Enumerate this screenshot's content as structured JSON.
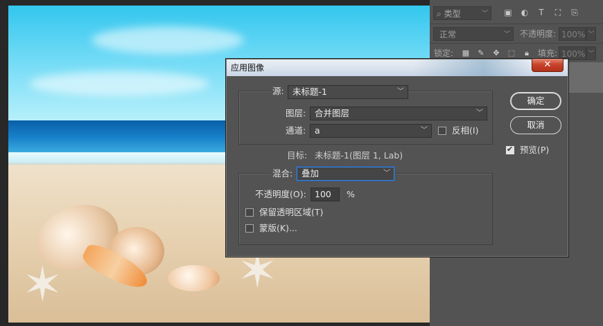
{
  "dialog": {
    "title": "应用图像",
    "close_glyph": "✕",
    "source_label": "源:",
    "source_value": "未标题-1",
    "layer_label": "图层:",
    "layer_value": "合并图层",
    "channel_label": "通道:",
    "channel_value": "a",
    "invert_label": "反相(I)",
    "invert_checked": false,
    "target_label": "目标:",
    "target_value": "未标题-1(图层 1, Lab)",
    "blending_label": "混合:",
    "blending_value": "叠加",
    "opacity_label": "不透明度(O):",
    "opacity_value": "100",
    "opacity_unit": "%",
    "preserve_transparency_label": "保留透明区域(T)",
    "preserve_transparency_checked": false,
    "mask_label": "蒙版(K)...",
    "mask_checked": false,
    "ok_label": "确定",
    "cancel_label": "取消",
    "preview_label": "预览(P)",
    "preview_checked": true
  },
  "layers_panel": {
    "kind_filter": "类型",
    "blend_mode": "正常",
    "opacity_label": "不透明度:",
    "opacity_value": "100%",
    "lock_label": "锁定:",
    "fill_label": "填充:",
    "fill_value": "100%"
  }
}
